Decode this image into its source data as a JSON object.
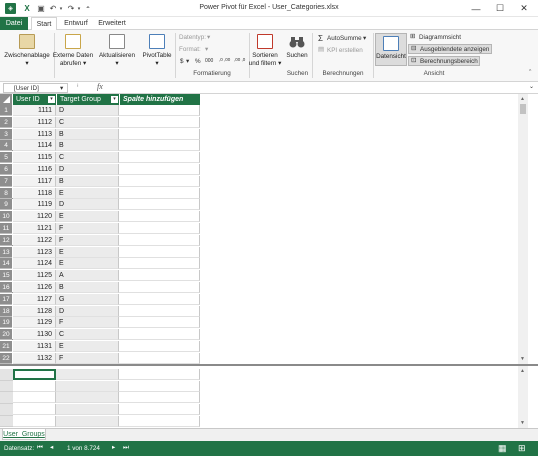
{
  "window": {
    "title": "Power Pivot für Excel - User_Categories.xlsx"
  },
  "tabs": [
    {
      "label": "Datei"
    },
    {
      "label": "Start"
    },
    {
      "label": "Entwurf"
    },
    {
      "label": "Erweitert"
    }
  ],
  "ribbon": {
    "clipboard_label": "Zwischenablage",
    "external_data_label_1": "Externe Daten",
    "external_data_label_2": "abrufen",
    "refresh_label": "Aktualisieren",
    "pivot_label": "PivotTable",
    "datatype_label": "Datentyp:",
    "format_label": "Format:",
    "currency_symbol": "$",
    "percent_symbol": "%",
    "thousands_symbol": "000",
    "decimal_inc": ",0 ,00",
    "decimal_dec": ",00 ,0",
    "formatting_group": "Formatierung",
    "sort_label_1": "Sortieren",
    "sort_label_2": "und filtern",
    "search_label": "Suchen",
    "search_group": "Suchen",
    "autosum_label": "AutoSumme",
    "kpi_label": "KPI erstellen",
    "calculations_group": "Berechnungen",
    "dataview_label": "Datensicht",
    "diagram_label": "Diagrammsicht",
    "hidden_label": "Ausgeblendete anzeigen",
    "calcarea_label": "Berechnungsbereich",
    "view_group": "Ansicht"
  },
  "formula_bar": {
    "name_box": "[User ID]",
    "fx": "fx",
    "value": ""
  },
  "grid": {
    "col_user_id": "User ID",
    "col_target_group": "Target Group",
    "col_add": "Spalte hinzufügen",
    "rows": [
      {
        "n": "1",
        "id": "1111",
        "g": "D"
      },
      {
        "n": "2",
        "id": "1112",
        "g": "C"
      },
      {
        "n": "3",
        "id": "1113",
        "g": "B"
      },
      {
        "n": "4",
        "id": "1114",
        "g": "B"
      },
      {
        "n": "5",
        "id": "1115",
        "g": "C"
      },
      {
        "n": "6",
        "id": "1116",
        "g": "D"
      },
      {
        "n": "7",
        "id": "1117",
        "g": "B"
      },
      {
        "n": "8",
        "id": "1118",
        "g": "E"
      },
      {
        "n": "9",
        "id": "1119",
        "g": "D"
      },
      {
        "n": "10",
        "id": "1120",
        "g": "E"
      },
      {
        "n": "11",
        "id": "1121",
        "g": "F"
      },
      {
        "n": "12",
        "id": "1122",
        "g": "F"
      },
      {
        "n": "13",
        "id": "1123",
        "g": "E"
      },
      {
        "n": "14",
        "id": "1124",
        "g": "E"
      },
      {
        "n": "15",
        "id": "1125",
        "g": "A"
      },
      {
        "n": "16",
        "id": "1126",
        "g": "B"
      },
      {
        "n": "17",
        "id": "1127",
        "g": "G"
      },
      {
        "n": "18",
        "id": "1128",
        "g": "D"
      },
      {
        "n": "19",
        "id": "1129",
        "g": "F"
      },
      {
        "n": "20",
        "id": "1130",
        "g": "C"
      },
      {
        "n": "21",
        "id": "1131",
        "g": "E"
      },
      {
        "n": "22",
        "id": "1132",
        "g": "F"
      }
    ]
  },
  "sheet_tab": {
    "label": "User_Groups"
  },
  "status": {
    "record_label": "Datensatz:",
    "record_value": "1 von 8.724"
  },
  "colors": {
    "accent": "#217346",
    "row_header": "#8e8e8e"
  }
}
